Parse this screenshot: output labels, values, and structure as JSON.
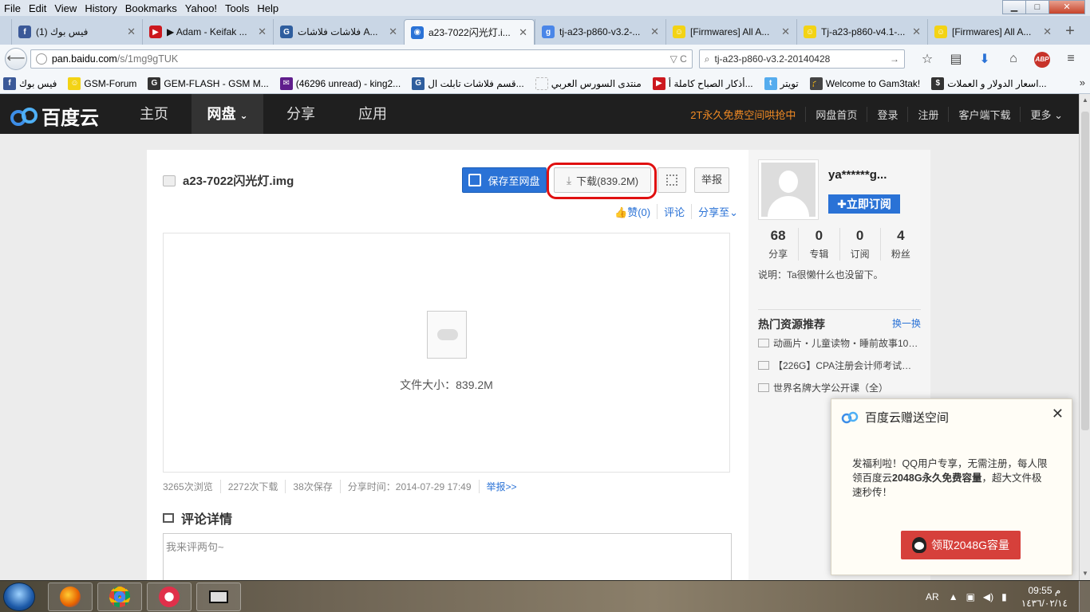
{
  "browser": {
    "menu": [
      "File",
      "Edit",
      "View",
      "History",
      "Bookmarks",
      "Yahoo!",
      "Tools",
      "Help"
    ],
    "window_controls": {
      "minimize": "▁",
      "maximize": "□",
      "close": "✕"
    },
    "tabs": [
      {
        "title": "(1) فيس بوك",
        "icon": "facebook-icon",
        "color": "#3b5998",
        "glyph": "f"
      },
      {
        "title": "▶ Adam - Keifak ...",
        "icon": "youtube-icon",
        "color": "#cc181e",
        "glyph": "▶"
      },
      {
        "title": "فلاشات فلاشات A...",
        "icon": "g-site-icon",
        "color": "#2f5e9e",
        "glyph": "G"
      },
      {
        "title": "a23-7022闪光灯.i...",
        "icon": "baidu-cloud-icon",
        "color": "#2a72d6",
        "glyph": "◉"
      },
      {
        "title": "tj-a23-p860-v3.2-...",
        "icon": "google-icon",
        "color": "#4a86e8",
        "glyph": "g"
      },
      {
        "title": "[Firmwares] All A...",
        "icon": "smiley-icon",
        "color": "#f3d315",
        "glyph": "☺"
      },
      {
        "title": "Tj-a23-p860-v4.1-...",
        "icon": "smiley-icon",
        "color": "#f3d315",
        "glyph": "☺"
      },
      {
        "title": "[Firmwares] All A...",
        "icon": "smiley-icon",
        "color": "#f3d315",
        "glyph": "☺"
      }
    ],
    "new_tab": "+",
    "url_host": "pan.baidu.com",
    "url_path": "/s/1mg9gTUK",
    "url_controls": "▽ C",
    "search_value": "tj-a23-p860-v3.2-20140428",
    "search_go": "→",
    "nav_glyphs": {
      "back": "⟵",
      "star": "☆",
      "reader": "▤",
      "download": "⬇",
      "home": "⌂",
      "abp": "ABP",
      "menu": "≡"
    },
    "bookmarks": [
      {
        "label": "فيس بوك",
        "icon": "facebook-icon",
        "color": "#3b5998",
        "glyph": "f"
      },
      {
        "label": "GSM-Forum",
        "icon": "smiley-icon",
        "color": "#f3d315",
        "glyph": "☺"
      },
      {
        "label": "GEM-FLASH - GSM M...",
        "icon": "g-site-icon",
        "color": "#333333",
        "glyph": "G"
      },
      {
        "label": "(46296 unread) - king2...",
        "icon": "yahoo-mail-icon",
        "color": "#5f1d8c",
        "glyph": "✉"
      },
      {
        "label": "قسم فلاشات تابلت ال...",
        "icon": "g-site-icon",
        "color": "#2f5e9e",
        "glyph": "G"
      },
      {
        "label": "منتدى السورس العربي",
        "icon": "blank-page-icon",
        "color": "#bbbbbb",
        "glyph": ""
      },
      {
        "label": "أذكار الصباح كاملة أ...",
        "icon": "youtube-icon",
        "color": "#cc181e",
        "glyph": "▶"
      },
      {
        "label": "تويتر",
        "icon": "twitter-icon",
        "color": "#55acee",
        "glyph": "t"
      },
      {
        "label": "Welcome to Gam3tak!",
        "icon": "graduation-cap-icon",
        "color": "#444444",
        "glyph": "🎓"
      },
      {
        "label": "اسعار الدولار و العملات...",
        "icon": "dollar-icon",
        "color": "#333333",
        "glyph": "$"
      }
    ],
    "bookmark_overflow": "»"
  },
  "baidu": {
    "logo_text": "百度云",
    "nav": [
      "主页",
      "网盘",
      "分享",
      "应用"
    ],
    "nav_dropdown": "⌄",
    "right_links": {
      "promo": "2T永久免费空间哄抢中",
      "links": [
        "网盘首页",
        "登录",
        "注册",
        "客户端下载",
        "更多 ⌄"
      ]
    },
    "file": {
      "name": "a23-7022闪光灯.img",
      "save_label": "保存至网盘",
      "download_label": "下载(839.2M)",
      "download_glyph": "⤓",
      "report_label": "举报",
      "actions": [
        "赞(0)",
        "评论",
        "分享至⌄"
      ],
      "size_text": "文件大小：839.2M"
    },
    "stats": {
      "views": "3265次浏览",
      "downloads": "2272次下载",
      "saves": "38次保存",
      "share_time": "分享时间：2014-07-29 17:49",
      "report_link": "举报>>"
    },
    "comments": {
      "heading": "评论详情",
      "placeholder": "我来评两句~"
    },
    "user": {
      "name": "ya******g...",
      "subscribe_label": "✚立即订阅",
      "stats": [
        {
          "n": "68",
          "label": "分享"
        },
        {
          "n": "0",
          "label": "专辑"
        },
        {
          "n": "0",
          "label": "订阅"
        },
        {
          "n": "4",
          "label": "粉丝"
        }
      ],
      "desc": "说明：Ta很懒什么也没留下。"
    },
    "hot": {
      "title": "热门资源推荐",
      "change": "换一换",
      "items": [
        "动画片・儿童读物・睡前故事10…",
        "【226G】CPA注册会计师考试全…",
        "世界名牌大学公开课（全）"
      ]
    },
    "popup": {
      "title": "百度云赠送空间",
      "close": "✕",
      "text_before": "发福利啦！QQ用户专享，无需注册，每人限领百度云",
      "text_bold": "2048G永久免费容量",
      "text_after": "，超大文件极速秒传！",
      "button": "领取2048G容量"
    }
  },
  "taskbar": {
    "lang": "AR",
    "tray_glyphs": [
      "▲",
      "▣",
      "◀)",
      "▮"
    ],
    "time": "09:55 م",
    "date": "١٤٣٦/٠٢/١٤"
  },
  "scroll_glyphs": {
    "up": "▲",
    "down": "▼"
  },
  "colors": {
    "baidu_blue": "#2a72d6",
    "promo_orange": "#f08a24",
    "highlight_red": "#e01010",
    "popup_button": "#d6403b"
  }
}
